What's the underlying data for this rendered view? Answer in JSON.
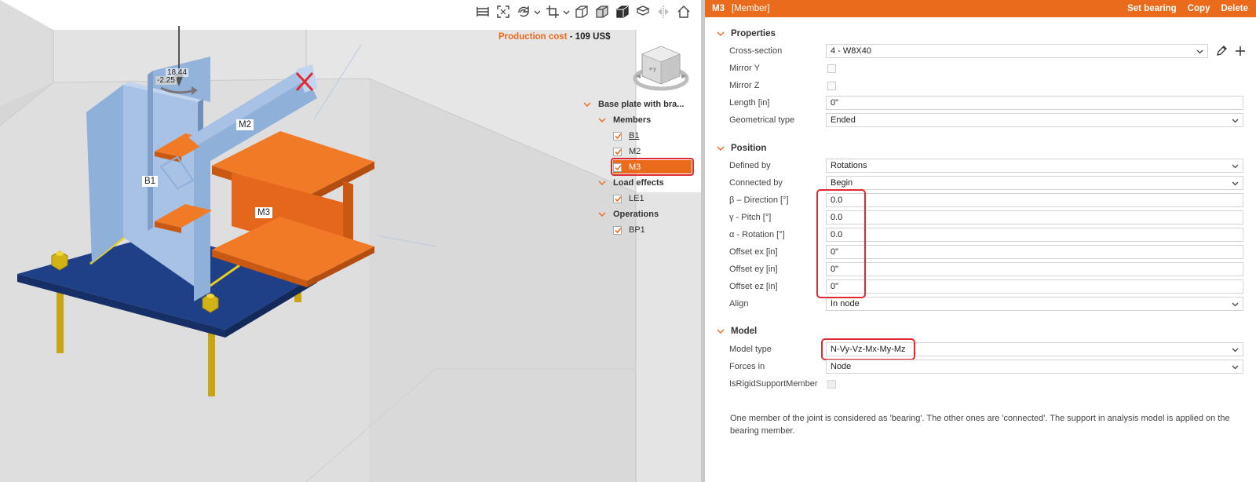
{
  "toolbar": {
    "buttons": [
      "measure-icon",
      "fit-view-icon",
      "rotate-view-icon",
      "crop-view-icon",
      "wireframe-icon",
      "transparent-view-icon",
      "solid-view-icon",
      "section-view-icon",
      "mirror-view-icon",
      "home-icon"
    ]
  },
  "viewport": {
    "cost_label": "Production cost",
    "cost_separator": " - ",
    "cost_value": "109 US$",
    "load_value_1": "18.44",
    "load_value_2": "-2.25",
    "member_labels": {
      "b1": "B1",
      "m2": "M2",
      "m3": "M3"
    },
    "navcube_axis_y": "+y",
    "colors": {
      "column": "#8fb0d8",
      "plate": "#1f3f86",
      "member_m3": "#e66a1e",
      "bolts": "#d1b316",
      "accent": "#ea6b1c"
    }
  },
  "tree": {
    "root": "Base plate with bra...",
    "members_group": "Members",
    "members": [
      "B1",
      "M2",
      "M3"
    ],
    "load_effects_group": "Load effects",
    "load_effects": [
      "LE1"
    ],
    "operations_group": "Operations",
    "operations": [
      "BP1"
    ],
    "selected": "M3"
  },
  "panel": {
    "header": {
      "name": "M3",
      "type": "[Member]",
      "set_bearing": "Set bearing",
      "copy": "Copy",
      "delete": "Delete"
    },
    "properties": {
      "title": "Properties",
      "cross_section_label": "Cross-section",
      "cross_section_value": "4 - W8X40",
      "mirror_y_label": "Mirror Y",
      "mirror_z_label": "Mirror Z",
      "length_label": "Length [in]",
      "length_value": "0\"",
      "geom_type_label": "Geometrical type",
      "geom_type_value": "Ended"
    },
    "position": {
      "title": "Position",
      "defined_by_label": "Defined by",
      "defined_by_value": "Rotations",
      "connected_by_label": "Connected by",
      "connected_by_value": "Begin",
      "direction_label": "β – Direction [°]",
      "direction_value": "0.0",
      "pitch_label": "γ - Pitch [°]",
      "pitch_value": "0.0",
      "rotation_label": "α - Rotation [°]",
      "rotation_value": "0.0",
      "offset_ex_label": "Offset ex [in]",
      "offset_ex_value": "0\"",
      "offset_ey_label": "Offset ey [in]",
      "offset_ey_value": "0\"",
      "offset_ez_label": "Offset ez [in]",
      "offset_ez_value": "0\"",
      "align_label": "Align",
      "align_value": "In node"
    },
    "model": {
      "title": "Model",
      "model_type_label": "Model type",
      "model_type_value": "N-Vy-Vz-Mx-My-Mz",
      "forces_in_label": "Forces in",
      "forces_in_value": "Node",
      "rigid_support_label": "IsRigidSupportMember"
    },
    "help_text": "One member of the joint is considered as 'bearing'. The other ones are 'connected'. The support in analysis model is applied on the bearing member."
  }
}
